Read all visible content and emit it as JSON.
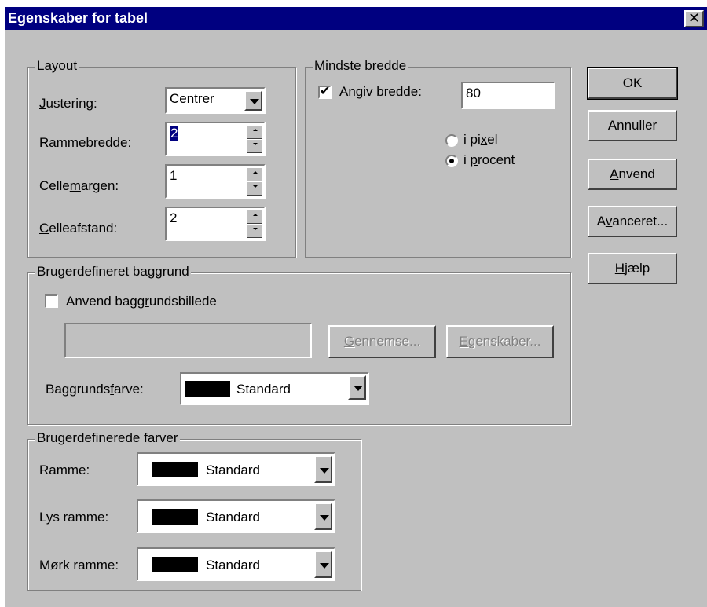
{
  "dialog": {
    "title": "Egenskaber for tabel"
  },
  "layout": {
    "legend": "Layout",
    "alignment_label": "Justering:",
    "alignment_value": "Centrer",
    "border_width_label": "Rammebredde:",
    "border_width_value": "2",
    "cell_margin_label": "Cellemargen:",
    "cell_margin_value": "1",
    "cell_spacing_label": "Celleafstand:",
    "cell_spacing_value": "2"
  },
  "min_width": {
    "legend": "Mindste bredde",
    "specify_width_label": "Angiv bredde:",
    "specify_width_checked": true,
    "width_value": "80",
    "pixel_label": "i pixel",
    "percent_label": "i procent",
    "selected_unit": "percent"
  },
  "buttons": {
    "ok": "OK",
    "cancel": "Annuller",
    "apply": "Anvend",
    "advanced": "Avanceret...",
    "help": "Hjælp"
  },
  "background": {
    "legend": "Brugerdefineret baggrund",
    "use_image_label": "Anvend baggrundsbillede",
    "use_image_checked": false,
    "image_path": "",
    "browse_label": "Gennemse...",
    "properties_label": "Egenskaber...",
    "bg_color_label": "Baggrundsfarve:",
    "bg_color_value": "Standard",
    "bg_color_swatch": "#000000"
  },
  "custom_colors": {
    "legend": "Brugerdefinerede farver",
    "border_label": "Ramme:",
    "border_value": "Standard",
    "light_border_label": "Lys ramme:",
    "light_border_value": "Standard",
    "dark_border_label": "Mørk ramme:",
    "dark_border_value": "Standard",
    "swatch_color": "#000000"
  }
}
